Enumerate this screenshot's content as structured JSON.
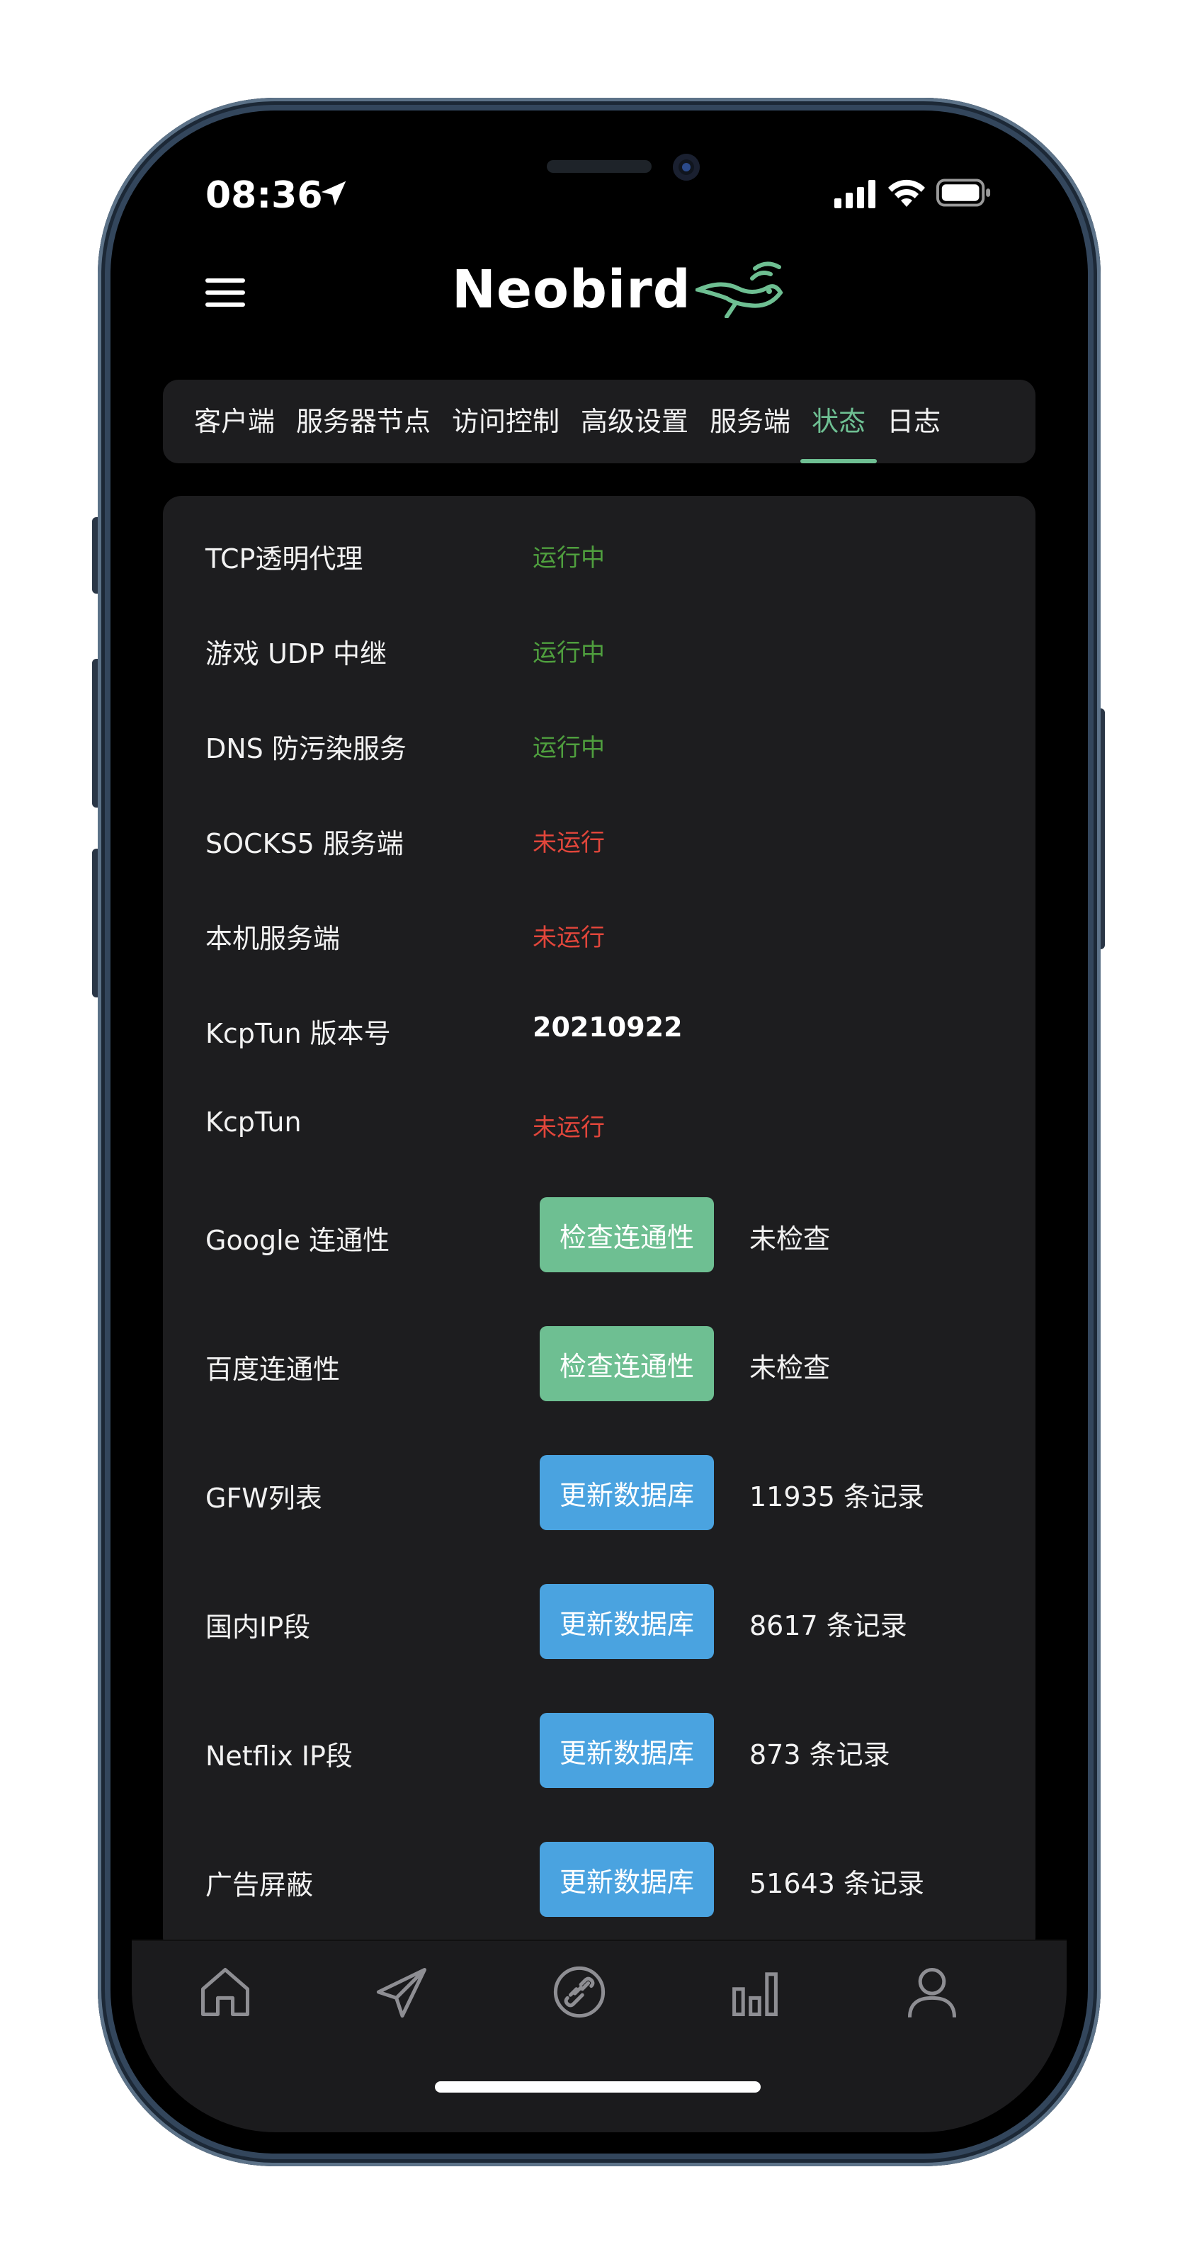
{
  "status_bar": {
    "time": "08:36"
  },
  "header": {
    "brand": "Neobird",
    "accent_color": "#6ebf92"
  },
  "tabs": [
    {
      "label": "客户端",
      "active": false
    },
    {
      "label": "服务器节点",
      "active": false
    },
    {
      "label": "访问控制",
      "active": false
    },
    {
      "label": "高级设置",
      "active": false
    },
    {
      "label": "服务端",
      "active": false
    },
    {
      "label": "状态",
      "active": true
    },
    {
      "label": "日志",
      "active": false
    }
  ],
  "status_rows": [
    {
      "label": "TCP透明代理",
      "value": "运行中",
      "state": "running"
    },
    {
      "label": "游戏 UDP 中继",
      "value": "运行中",
      "state": "running"
    },
    {
      "label": "DNS 防污染服务",
      "value": "运行中",
      "state": "running"
    },
    {
      "label": "SOCKS5 服务端",
      "value": "未运行",
      "state": "stopped"
    },
    {
      "label": "本机服务端",
      "value": "未运行",
      "state": "stopped"
    },
    {
      "label": "KcpTun 版本号",
      "value": "20210922",
      "state": "info"
    },
    {
      "label": "KcpTun",
      "value": "未运行",
      "state": "stopped"
    }
  ],
  "action_rows": [
    {
      "label": "Google 连通性",
      "button": "检查连通性",
      "result": "未检查",
      "color": "green"
    },
    {
      "label": "百度连通性",
      "button": "检查连通性",
      "result": "未检查",
      "color": "green"
    },
    {
      "label": "GFW列表",
      "button": "更新数据库",
      "result": "11935 条记录",
      "color": "blue"
    },
    {
      "label": "国内IP段",
      "button": "更新数据库",
      "result": "8617 条记录",
      "color": "blue"
    },
    {
      "label": "Netflix IP段",
      "button": "更新数据库",
      "result": "873 条记录",
      "color": "blue"
    },
    {
      "label": "广告屏蔽",
      "button": "更新数据库",
      "result": "51643 条记录",
      "color": "blue"
    }
  ],
  "bottom_nav": [
    {
      "icon": "home-icon"
    },
    {
      "icon": "send-icon"
    },
    {
      "icon": "link-icon"
    },
    {
      "icon": "bar-chart-icon"
    },
    {
      "icon": "user-icon"
    }
  ],
  "colors": {
    "running": "#4f9f3e",
    "stopped": "#e2463b",
    "button_green": "#6ebf92",
    "button_blue": "#4aa3e0"
  }
}
